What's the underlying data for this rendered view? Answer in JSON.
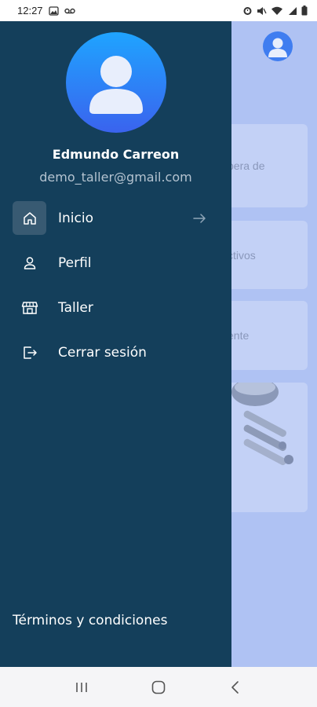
{
  "status_bar": {
    "time": "12:27",
    "left_icons": [
      "gallery-icon",
      "voicemail-icon"
    ],
    "right_icons": [
      "alarm-icon",
      "mute-icon",
      "wifi-icon",
      "signal-icon",
      "battery-icon"
    ]
  },
  "drawer": {
    "user": {
      "name": "Edmundo Carreon",
      "email": "demo_taller@gmail.com"
    },
    "menu": [
      {
        "label": "Inicio",
        "icon": "home-icon",
        "active": true
      },
      {
        "label": "Perfil",
        "icon": "user-icon",
        "active": false
      },
      {
        "label": "Taller",
        "icon": "store-icon",
        "active": false
      },
      {
        "label": "Cerrar sesión",
        "icon": "logout-icon",
        "active": false
      }
    ],
    "footer_link": "Términos y condiciones"
  },
  "background": {
    "cards": [
      "pera de",
      "ctivos",
      "ente"
    ]
  },
  "colors": {
    "drawer_bg": "#143f5b",
    "active_item_bg": "#385a72",
    "overlay_bg": "#afc2f3",
    "avatar_gradient_top": "#1fa4ff",
    "avatar_gradient_bottom": "#3a63ee"
  },
  "nav_bar": {
    "buttons": [
      "recent-apps-icon",
      "home-button-icon",
      "back-icon"
    ]
  }
}
